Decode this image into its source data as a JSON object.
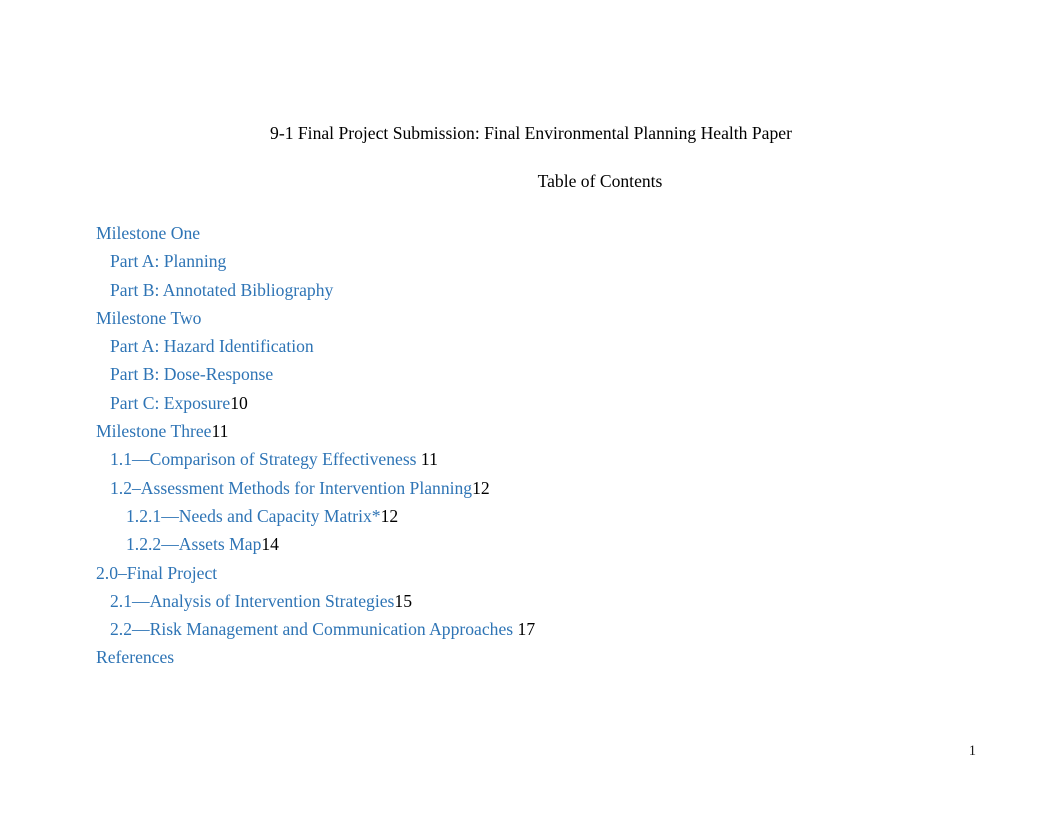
{
  "document": {
    "title": "9-1 Final Project Submission: Final Environmental Planning Health Paper",
    "toc_heading": "Table of Contents",
    "footer_page_number": "1",
    "link_color": "#2E74B5",
    "text_color": "#000000"
  },
  "toc": {
    "entries": [
      {
        "label": "Milestone One",
        "page": "",
        "level": 0
      },
      {
        "label": "Part A: Planning",
        "page": "",
        "level": 1
      },
      {
        "label": "Part B: Annotated Bibliography",
        "page": "",
        "level": 1
      },
      {
        "label": "Milestone Two",
        "page": "",
        "level": 0
      },
      {
        "label": "Part A: Hazard Identification",
        "page": "",
        "level": 1
      },
      {
        "label": "Part B: Dose-Response",
        "page": "",
        "level": 1
      },
      {
        "label": "Part C: Exposure",
        "page": "10",
        "level": 1
      },
      {
        "label": "Milestone Three",
        "page": "11",
        "level": 0
      },
      {
        "label": "1.1—Comparison of Strategy Effectiveness",
        "page": " 11",
        "level": 1
      },
      {
        "label": "1.2–Assessment Methods for Intervention Planning",
        "page": "12",
        "level": 1
      },
      {
        "label": "1.2.1—Needs and Capacity Matrix*",
        "page": "12",
        "level": 2
      },
      {
        "label": "1.2.2—Assets Map",
        "page": "14",
        "level": 2
      },
      {
        "label": "2.0–Final Project",
        "page": "",
        "level": 0
      },
      {
        "label": "2.1—Analysis of Intervention Strategies",
        "page": "15",
        "level": 1
      },
      {
        "label": "2.2—Risk Management and Communication Approaches",
        "page": " 17",
        "level": 1
      },
      {
        "label": "References",
        "page": "",
        "level": 0
      }
    ]
  }
}
